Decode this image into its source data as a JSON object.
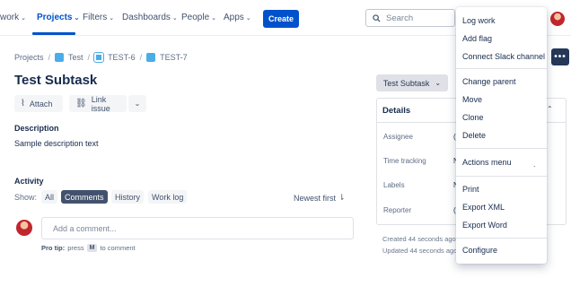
{
  "nav": {
    "items": [
      {
        "label": "work",
        "active": false
      },
      {
        "label": "Projects",
        "active": true
      },
      {
        "label": "Filters",
        "active": false
      },
      {
        "label": "Dashboards",
        "active": false
      },
      {
        "label": "People",
        "active": false
      },
      {
        "label": "Apps",
        "active": false
      }
    ],
    "create_label": "Create",
    "search_placeholder": "Search"
  },
  "breadcrumb": [
    "Projects",
    "Test",
    "TEST-6",
    "TEST-7"
  ],
  "issue": {
    "title": "Test Subtask",
    "actions": [
      "Attach",
      "Link issue"
    ],
    "description_heading": "Description",
    "description_text": "Sample description text"
  },
  "activity": {
    "heading": "Activity",
    "show_label": "Show:",
    "filters": [
      "All",
      "Comments",
      "History",
      "Work log"
    ],
    "selected_filter": "Comments",
    "sort_label": "Newest first",
    "comment_placeholder": "Add a comment...",
    "protip_bold": "Pro tip:",
    "protip_press": "press",
    "protip_key": "M",
    "protip_end": "to comment"
  },
  "details": {
    "status_label": "Test Subtask",
    "heading": "Details",
    "fields": [
      {
        "label": "Assignee",
        "frag": "("
      },
      {
        "label": "Time tracking",
        "frag": "N"
      },
      {
        "label": "Labels",
        "frag": "N"
      },
      {
        "label": "Reporter",
        "frag": "("
      }
    ],
    "created": "Created 44 seconds ago",
    "updated": "Updated 44 seconds ago",
    "more_label": "•••"
  },
  "menu": {
    "items": [
      "Log work",
      "Add flag",
      "Connect Slack channel",
      "Change parent",
      "Move",
      "Clone",
      "Delete",
      "Actions menu",
      "Print",
      "Export XML",
      "Export Word",
      "Configure"
    ],
    "actions_menu_hint": "."
  },
  "colors": {
    "brand": "#0052cc",
    "selected_chip": "#42526e",
    "dark_button": "#253858"
  }
}
